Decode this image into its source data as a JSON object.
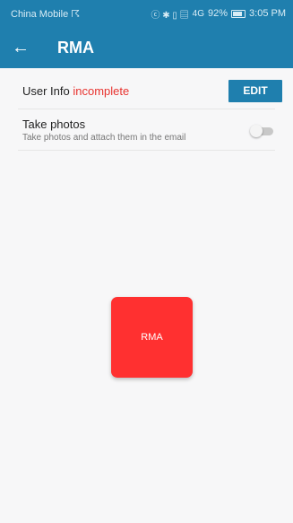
{
  "status_bar": {
    "carrier": "China Mobile ☈",
    "icons": "ⓒ ✱ ▯ ▤",
    "network": "4G",
    "battery": "92%",
    "time": "3:05 PM"
  },
  "app_bar": {
    "back_icon": "←",
    "title": "RMA"
  },
  "user_info": {
    "label": "User Info",
    "status": "incomplete",
    "edit_label": "EDIT"
  },
  "take_photos": {
    "title": "Take photos",
    "subtitle": "Take photos and attach them in the email",
    "enabled": false
  },
  "main": {
    "rma_button_label": "RMA"
  },
  "colors": {
    "primary": "#1f7fae",
    "accent": "#ff3030",
    "incomplete": "#e8332f"
  }
}
